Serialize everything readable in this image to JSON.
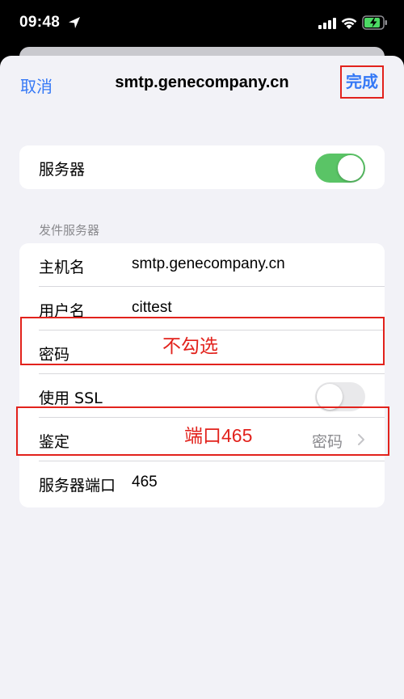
{
  "status_bar": {
    "time": "09:48"
  },
  "nav": {
    "cancel_label": "取消",
    "title": "smtp.genecompany.cn",
    "done_label": "完成"
  },
  "server_toggle": {
    "label": "服务器",
    "on": true
  },
  "outgoing": {
    "section_header": "发件服务器",
    "host_label": "主机名",
    "host_value": "smtp.genecompany.cn",
    "user_label": "用户名",
    "user_value": "cittest",
    "password_label": "密码",
    "ssl_label": "使用 SSL",
    "ssl_on": false,
    "auth_label": "鉴定",
    "auth_value": "密码",
    "port_label": "服务器端口",
    "port_value": "465"
  },
  "annotations": {
    "ssl_note": "不勾选",
    "port_note": "端口465",
    "color": "#e2221c"
  },
  "colors": {
    "accent": "#3478f6",
    "toggle_on": "#5ac466",
    "background": "#f2f2f7"
  }
}
